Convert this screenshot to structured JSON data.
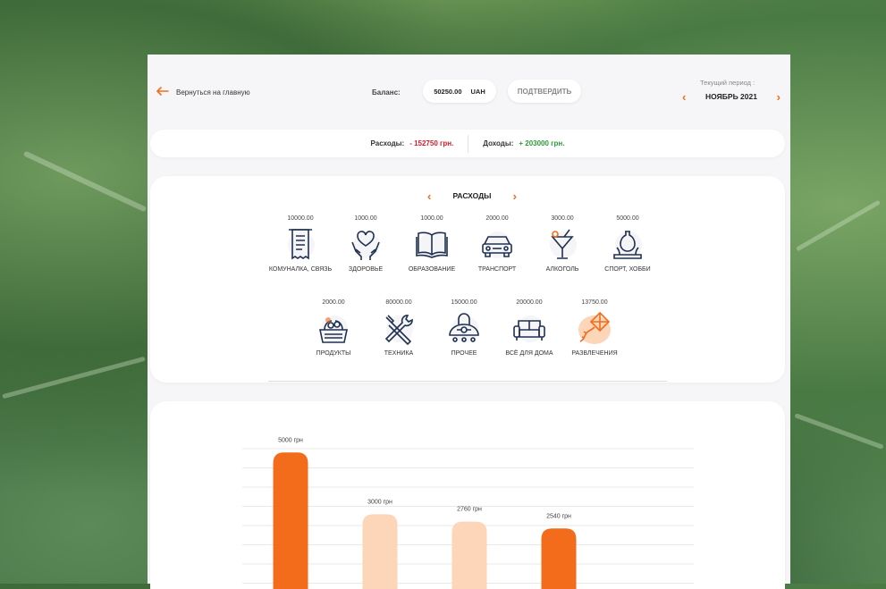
{
  "header": {
    "back_label": "Вернуться на главную",
    "balance_label": "Баланс:",
    "balance_value": "50250.00",
    "currency": "UAH",
    "confirm_label": "ПОДТВЕРДИТЬ",
    "period_label": "Текущий период :",
    "period_value": "НОЯБРЬ 2021"
  },
  "summary": {
    "expenses_label": "Расходы:",
    "expenses_value": "- 152750 грн.",
    "income_label": "Доходы:",
    "income_value": "+ 203000 грн."
  },
  "categories": {
    "title": "РАСХОДЫ",
    "items": [
      {
        "amount": "10000.00",
        "name": "КОМУНАЛКА, СВЯЗЬ",
        "icon": "receipt-icon"
      },
      {
        "amount": "1000.00",
        "name": "ЗДОРОВЬЕ",
        "icon": "heart-hands-icon"
      },
      {
        "amount": "1000.00",
        "name": "ОБРАЗОВАНИЕ",
        "icon": "book-icon"
      },
      {
        "amount": "2000.00",
        "name": "ТРАНСПОРТ",
        "icon": "car-icon"
      },
      {
        "amount": "3000.00",
        "name": "АЛКОГОЛЬ",
        "icon": "cocktail-icon"
      },
      {
        "amount": "5000.00",
        "name": "СПОРТ, ХОББИ",
        "icon": "pottery-icon"
      },
      {
        "amount": "2000.00",
        "name": "ПРОДУКТЫ",
        "icon": "grocery-basket-icon"
      },
      {
        "amount": "80000.00",
        "name": "ТЕХНИКА",
        "icon": "tools-icon"
      },
      {
        "amount": "15000.00",
        "name": "ПРОЧЕЕ",
        "icon": "robot-vacuum-icon"
      },
      {
        "amount": "20000.00",
        "name": "ВСЁ ДЛЯ ДОМА",
        "icon": "sofa-icon"
      },
      {
        "amount": "13750.00",
        "name": "РАЗВЛЕЧЕНИЯ",
        "icon": "kite-icon"
      }
    ]
  },
  "colors": {
    "accent": "#f26c1b",
    "accent_light": "#fdd5b8",
    "icon_stroke": "#1f3050",
    "negative": "#d91a2a",
    "positive": "#2a9a3a"
  },
  "chart_data": {
    "type": "bar",
    "categories": [
      "",
      "",
      "",
      ""
    ],
    "values": [
      5000,
      3000,
      2760,
      2540
    ],
    "value_labels": [
      "5000 грн",
      "3000 грн",
      "2760 грн",
      "2540 грн"
    ],
    "bar_colors": [
      "#f26c1b",
      "#fdd5b8",
      "#fdd5b8",
      "#f26c1b"
    ],
    "ylim": [
      0,
      5500
    ],
    "grid": true
  }
}
